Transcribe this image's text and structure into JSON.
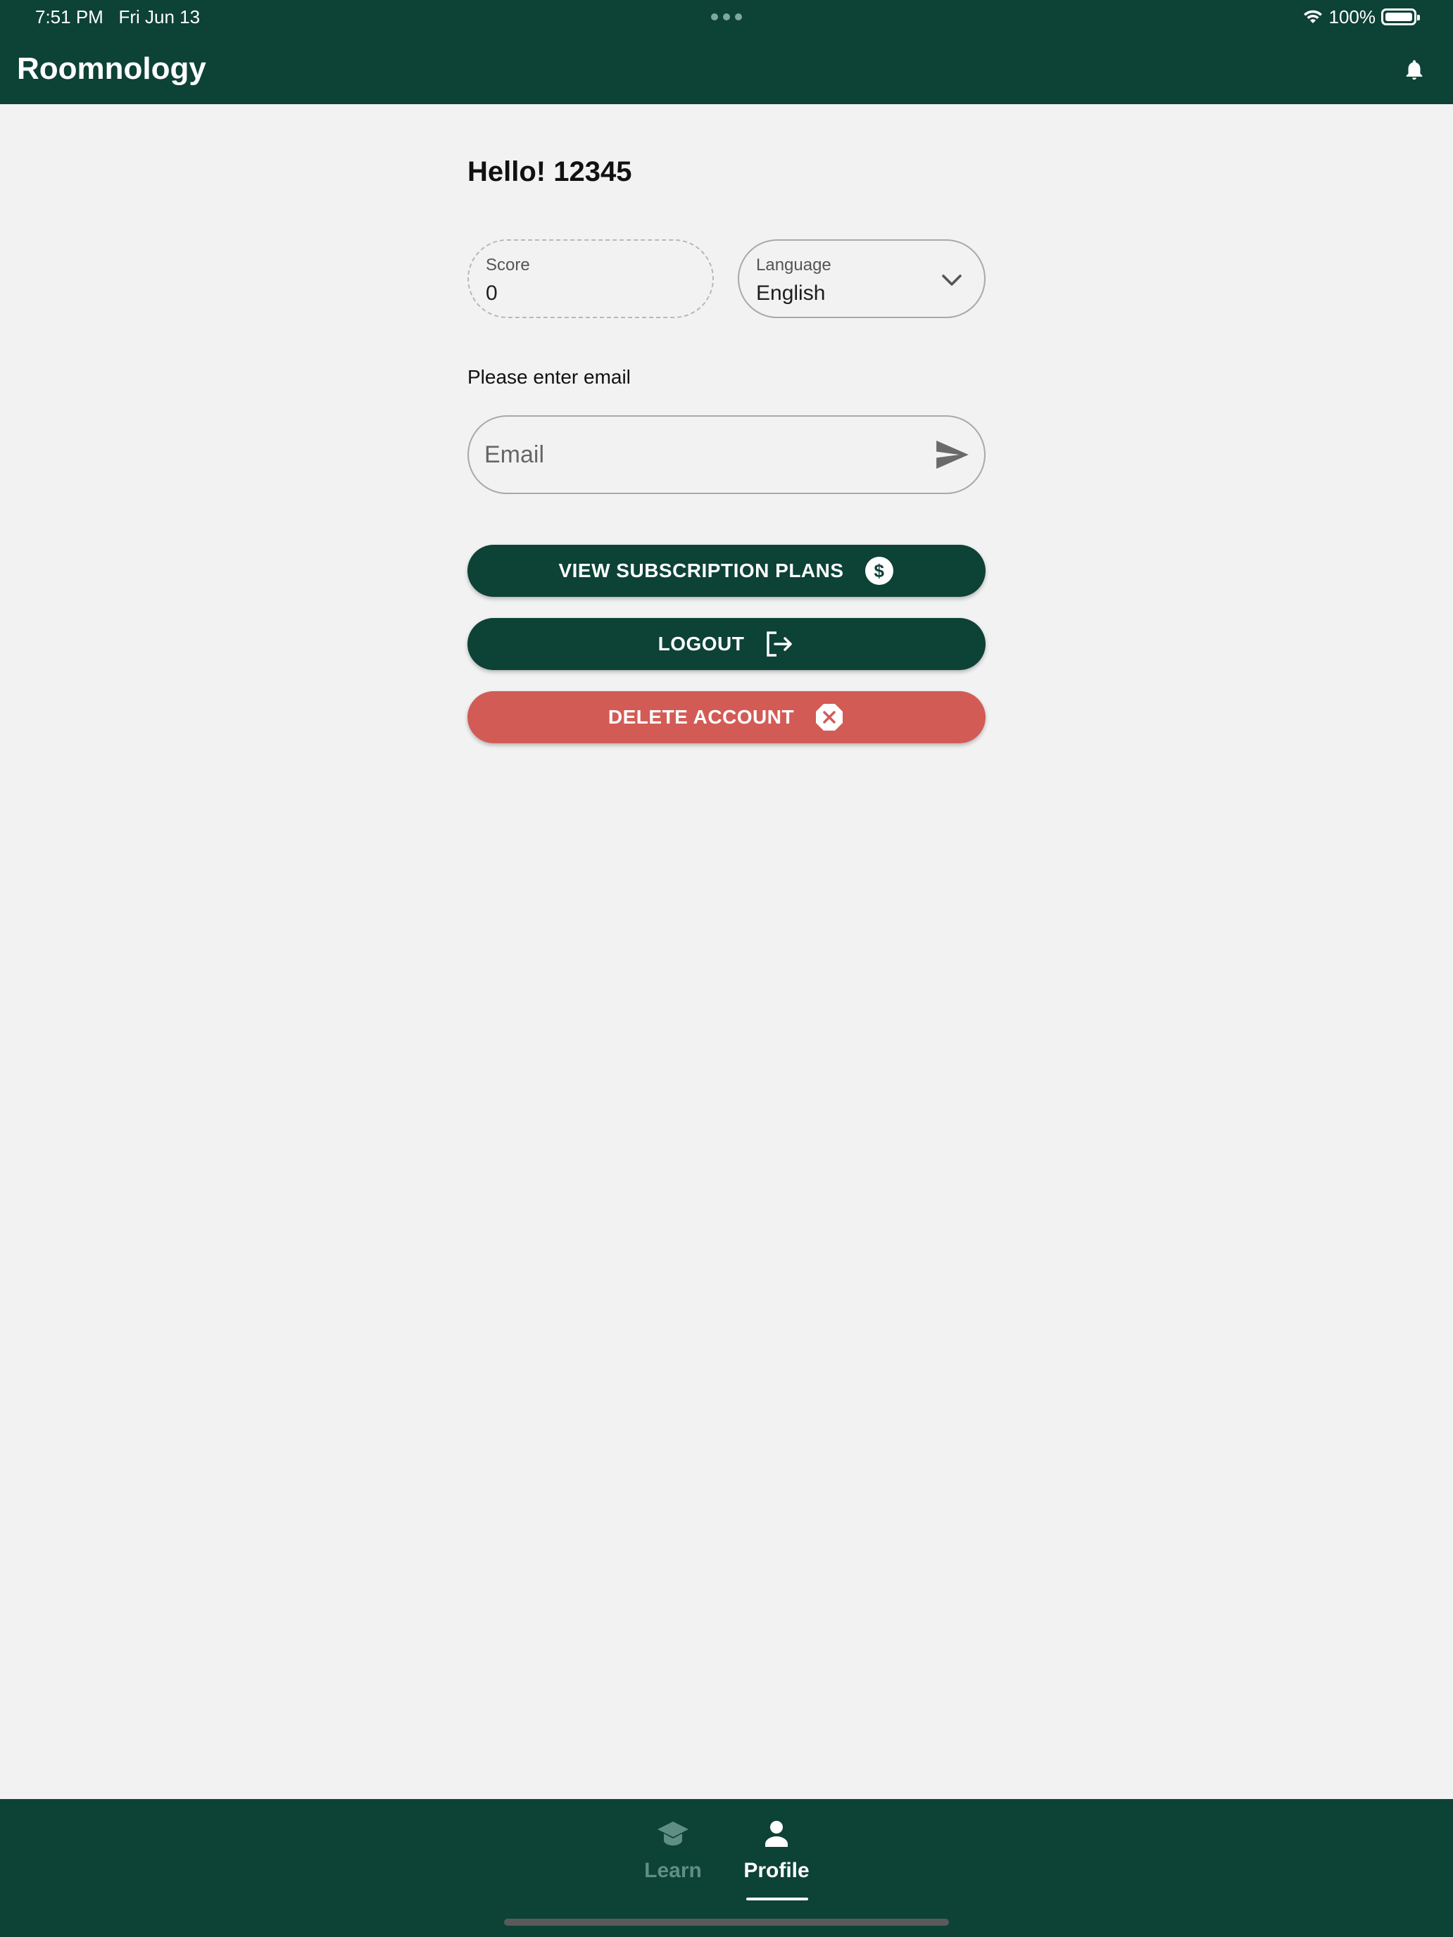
{
  "status_bar": {
    "time": "7:51 PM",
    "date": "Fri Jun 13",
    "battery": "100%"
  },
  "header": {
    "title": "Roomnology",
    "notification_icon": "bell-icon"
  },
  "profile": {
    "greeting": "Hello! 12345",
    "score": {
      "label": "Score",
      "value": "0"
    },
    "language": {
      "label": "Language",
      "value": "English"
    },
    "email_prompt": "Please enter email",
    "email_input": {
      "placeholder": "Email",
      "value": ""
    }
  },
  "actions": {
    "subscription_label": "VIEW SUBSCRIPTION PLANS",
    "logout_label": "LOGOUT",
    "delete_label": "DELETE ACCOUNT"
  },
  "bottom_nav": {
    "items": [
      {
        "label": "Learn",
        "icon": "graduation-cap-icon",
        "active": false
      },
      {
        "label": "Profile",
        "icon": "person-icon",
        "active": true
      }
    ]
  },
  "colors": {
    "primary": "#0d4236",
    "danger": "#d35b56",
    "background": "#f2f2f2",
    "inactive_nav": "#5f8f82"
  }
}
